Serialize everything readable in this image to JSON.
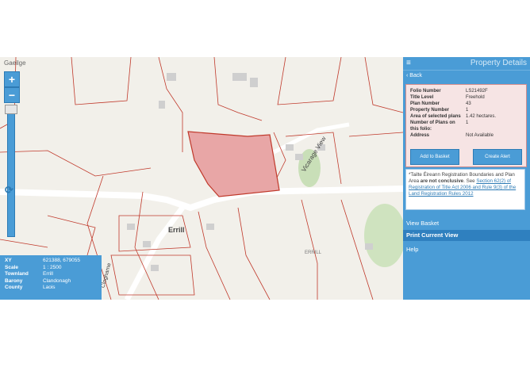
{
  "map": {
    "language": "Gaeilge",
    "zoom_in": "+",
    "zoom_out": "−",
    "refresh": "⟳",
    "labels": {
      "town": "Errill",
      "road_vicarage": "Vicarage View",
      "road_clogharne": "Clogharne",
      "errill_small": "ERRILL"
    },
    "info": {
      "rows": [
        {
          "k": "XY",
          "v": "621388, 679055"
        },
        {
          "k": "Scale",
          "v": "1 : 2500"
        },
        {
          "k": "Townland",
          "v": "Errill"
        },
        {
          "k": "Barony",
          "v": "Clandonagh"
        },
        {
          "k": "County",
          "v": "Laois"
        }
      ]
    }
  },
  "panel": {
    "menu_icon": "≡",
    "title": "Property Details",
    "back": "‹ Back",
    "details": [
      {
        "k": "Folio Number",
        "v": "LS21492F"
      },
      {
        "k": "Title Level",
        "v": "Freehold"
      },
      {
        "k": "Plan Number",
        "v": "43"
      },
      {
        "k": "Property Number",
        "v": "1"
      },
      {
        "k": "Area of selected plans",
        "v": "1.42 hectares."
      },
      {
        "k": "Number of Plans on this folio:",
        "v": "1"
      },
      {
        "k": "Address",
        "v": "Not Available"
      }
    ],
    "add_basket": "Add to Basket",
    "create_alert": "Create Alert",
    "notice": {
      "prefix": "*Tailte Éireann Registration Boundaries and Plan Area ",
      "bold": "are not conclusive",
      "mid": ". See ",
      "link": "Section 62(2) of Registration of Title Act 2006 and Rule 9(3) of the Land Registration Rules 2012"
    },
    "view_basket": "View Basket",
    "print_view": "Print Current View",
    "help": "Help"
  },
  "colors": {
    "accent": "#4a9cd6",
    "highlight": "#e8a6a6",
    "parcel_line": "#c0392b"
  }
}
